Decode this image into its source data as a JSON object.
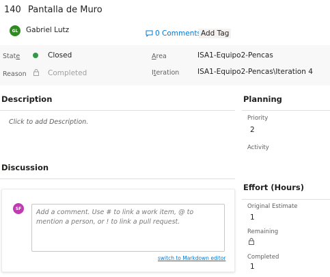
{
  "work_item": {
    "id": "140",
    "title": "Pantalla de Muro",
    "assigned_to": {
      "name": "Gabriel Lutz",
      "initials": "GL",
      "avatar_color": "#2e8b1f"
    },
    "comments_link": "0 Comments",
    "add_tag_label": "Add Tag"
  },
  "fields": {
    "state": {
      "label": "State",
      "underline": "e",
      "value": "Closed",
      "dot_color": "#339947"
    },
    "reason": {
      "label": "Reason",
      "value": "Completed"
    },
    "area": {
      "label": "Area",
      "underline": "A",
      "value": "ISA1-Equipo2-Pencas"
    },
    "iteration": {
      "label": "Iteration",
      "underline": "t",
      "value": "ISA1-Equipo2-Pencas\\Iteration 4"
    }
  },
  "description": {
    "heading": "Description",
    "placeholder": "Click to add Description."
  },
  "discussion": {
    "heading": "Discussion",
    "user_initials": "SF",
    "user_avatar_color": "#c239b3",
    "comment_placeholder": "Add a comment. Use # to link a work item, @ to mention a person, or ! to link a pull request.",
    "markdown_link": "switch to Markdown editor"
  },
  "planning": {
    "heading": "Planning",
    "priority_label": "Priority",
    "priority_value": "2",
    "activity_label": "Activity"
  },
  "effort": {
    "heading": "Effort (Hours)",
    "original_estimate_label": "Original Estimate",
    "original_estimate_value": "1",
    "remaining_label": "Remaining",
    "completed_label": "Completed",
    "completed_value": "1"
  },
  "colors": {
    "accent": "#0078d4",
    "band_bg": "#f8f8f8"
  }
}
